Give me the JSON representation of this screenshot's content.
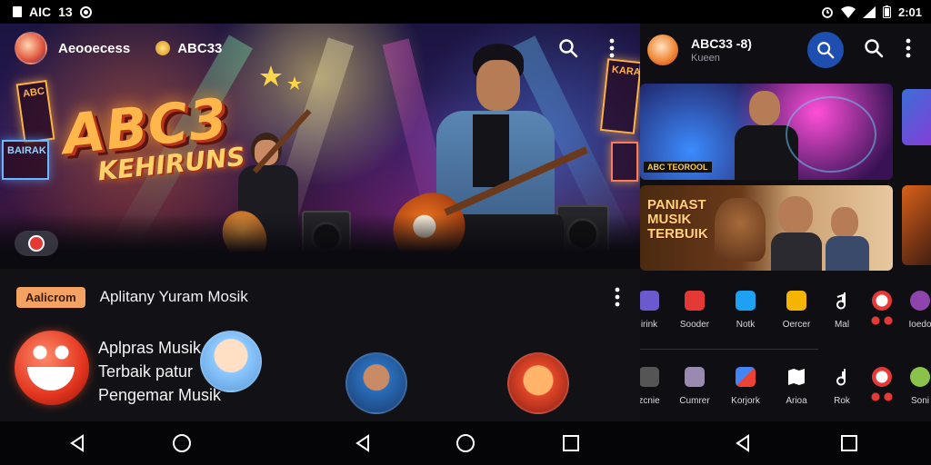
{
  "status_bar": {
    "left_text": "AIC",
    "left_number": "13",
    "time": "2:01"
  },
  "left_app": {
    "header_name": "Aeooecess",
    "header_badge": "ABC33",
    "hero": {
      "logo_title": "ABC3",
      "logo_subtitle": "KEHIRUNS",
      "sign_1": "ABC",
      "sign_2": "BAIRAK",
      "sign_3": "KARAOKE"
    },
    "caption": {
      "tag": "Aalicrom",
      "text": "Aplitany Yuram Mosik"
    },
    "promo": {
      "line1": "Aplpras Musik",
      "line2": "Terbaik patur",
      "line3": "Pengemar Musik"
    }
  },
  "right_app": {
    "title": "ABC33 -8)",
    "subtitle": "Kueen",
    "card1_label": "ABC TEOROOL",
    "card2_line1": "PANIAST",
    "card2_line2": "MUSIK",
    "card2_line3": "TERBUIK",
    "grid_row1": [
      "irink",
      "Sooder",
      "Notk",
      "Oercer",
      "Mal",
      "",
      "Ioedo"
    ],
    "grid_row2": [
      "zcnie",
      "Cumrer",
      "Korjork",
      "Arioa",
      "Rok",
      "",
      "Soni"
    ]
  },
  "colors": {
    "accent": "#1e4fb0",
    "tag_bg": "#f4a261",
    "logo": "#ffb64a"
  },
  "icons": {
    "search": "search-icon",
    "more": "more-vert-icon",
    "back": "back-triangle-icon",
    "home": "home-circle-icon",
    "recents": "recents-square-icon"
  }
}
